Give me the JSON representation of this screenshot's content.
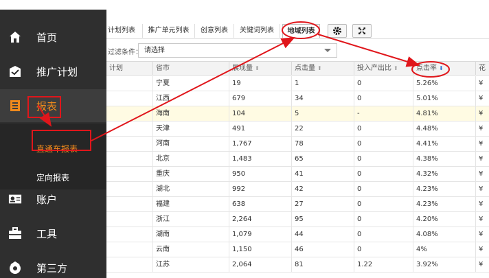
{
  "sidebar": {
    "items": [
      {
        "label": "首页",
        "icon": "home-icon"
      },
      {
        "label": "推广计划",
        "icon": "campaign-icon"
      },
      {
        "label": "报表",
        "icon": "report-icon"
      },
      {
        "label": "账户",
        "icon": "account-icon"
      },
      {
        "label": "工具",
        "icon": "toolbox-icon"
      },
      {
        "label": "第三方",
        "icon": "third-party-icon"
      }
    ],
    "sub_items": [
      {
        "label": "直通车报表"
      },
      {
        "label": "定向报表"
      }
    ],
    "accent_color": "#f08a1c"
  },
  "tabs": [
    {
      "label": "计划列表"
    },
    {
      "label": "推广单元列表"
    },
    {
      "label": "创意列表"
    },
    {
      "label": "关键词列表"
    },
    {
      "label": "地域列表"
    }
  ],
  "toolbar": {
    "settings_icon": "gear-icon",
    "fullscreen_icon": "expand-icon"
  },
  "filter": {
    "label": "过滤条件：",
    "selected": "请选择"
  },
  "table": {
    "columns": [
      "计划",
      "省市",
      "展现量",
      "点击量",
      "投入产出比",
      "点击率",
      "花"
    ],
    "rows": [
      {
        "province": "宁夏",
        "impressions": "19",
        "clicks": "1",
        "roi": "0",
        "ctr": "5.26%",
        "cost": "¥"
      },
      {
        "province": "江西",
        "impressions": "679",
        "clicks": "34",
        "roi": "0",
        "ctr": "5.01%",
        "cost": "¥"
      },
      {
        "province": "海南",
        "impressions": "104",
        "clicks": "5",
        "roi": "-",
        "ctr": "4.81%",
        "cost": "¥"
      },
      {
        "province": "天津",
        "impressions": "491",
        "clicks": "22",
        "roi": "0",
        "ctr": "4.48%",
        "cost": "¥"
      },
      {
        "province": "河南",
        "impressions": "1,767",
        "clicks": "78",
        "roi": "0",
        "ctr": "4.41%",
        "cost": "¥"
      },
      {
        "province": "北京",
        "impressions": "1,483",
        "clicks": "65",
        "roi": "0",
        "ctr": "4.38%",
        "cost": "¥"
      },
      {
        "province": "重庆",
        "impressions": "950",
        "clicks": "41",
        "roi": "0",
        "ctr": "4.32%",
        "cost": "¥"
      },
      {
        "province": "湖北",
        "impressions": "992",
        "clicks": "42",
        "roi": "0",
        "ctr": "4.23%",
        "cost": "¥"
      },
      {
        "province": "福建",
        "impressions": "638",
        "clicks": "27",
        "roi": "0",
        "ctr": "4.23%",
        "cost": "¥"
      },
      {
        "province": "浙江",
        "impressions": "2,264",
        "clicks": "95",
        "roi": "0",
        "ctr": "4.20%",
        "cost": "¥"
      },
      {
        "province": "湖南",
        "impressions": "1,079",
        "clicks": "44",
        "roi": "0",
        "ctr": "4.08%",
        "cost": "¥"
      },
      {
        "province": "云南",
        "impressions": "1,150",
        "clicks": "46",
        "roi": "0",
        "ctr": "4%",
        "cost": "¥"
      },
      {
        "province": "江苏",
        "impressions": "2,064",
        "clicks": "81",
        "roi": "1.22",
        "ctr": "3.92%",
        "cost": "¥"
      }
    ]
  },
  "annotation_color": "#e0161b"
}
